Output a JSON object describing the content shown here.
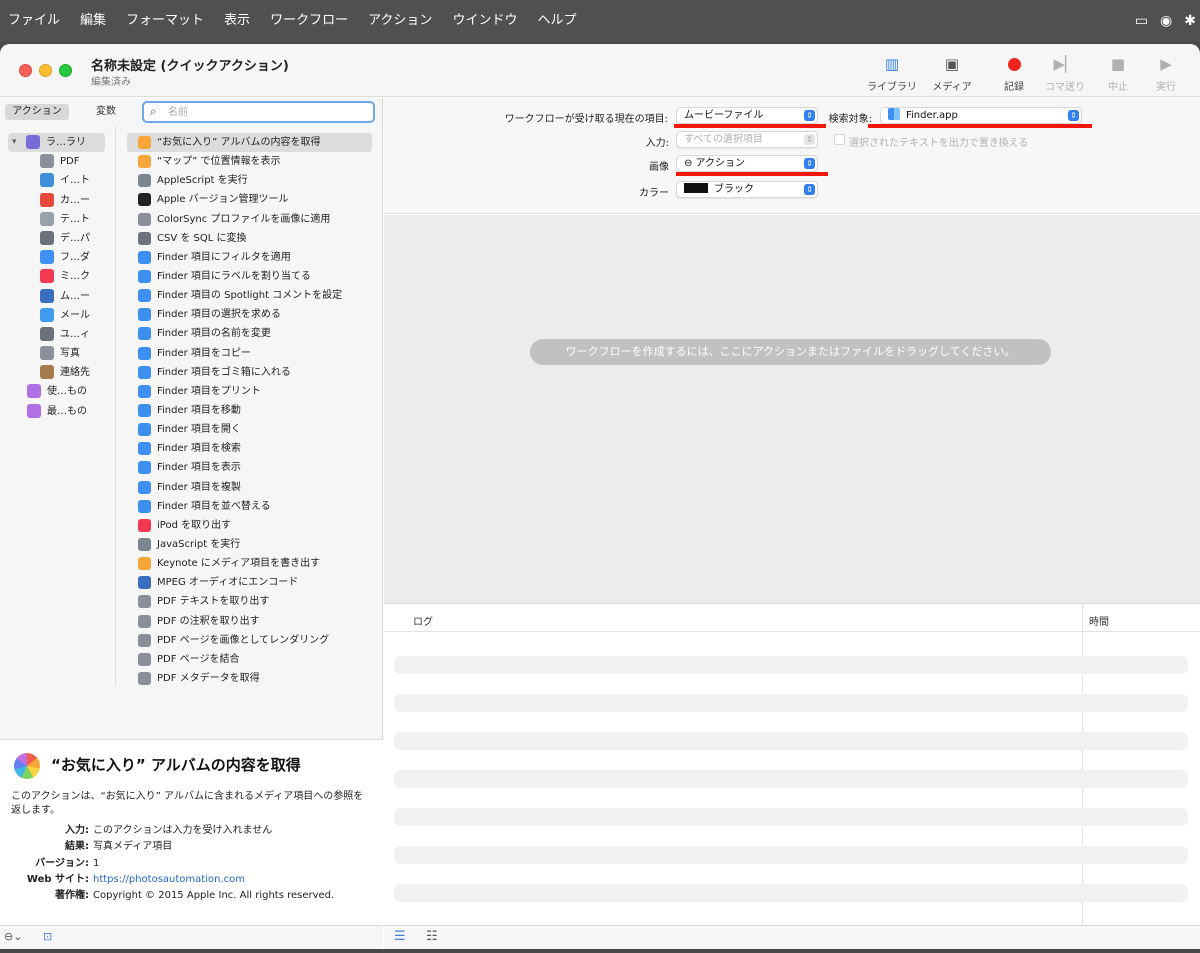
{
  "menubar": {
    "items": [
      "ファイル",
      "編集",
      "フォーマット",
      "表示",
      "ワークフロー",
      "アクション",
      "ウインドウ",
      "ヘルプ"
    ],
    "tray_icons": [
      "display-icon",
      "airplay-icon",
      "bluetooth-icon"
    ]
  },
  "window": {
    "title": "名称未設定 (クイックアクション)",
    "subtitle": "編集済み"
  },
  "toolbar": {
    "library": "ライブラリ",
    "media": "メディア",
    "record": "記録",
    "step": "コマ送り",
    "stop": "中止",
    "run": "実行"
  },
  "left_tabs": {
    "actions": "アクション",
    "variables": "変数",
    "search_placeholder": "名前"
  },
  "library": {
    "root": "ラ…ラリ",
    "items": [
      {
        "label": "PDF",
        "icon": "pdf-icon",
        "color": "#8a8f99"
      },
      {
        "label": "イ…ト",
        "icon": "globe-icon",
        "color": "#3f8fd8"
      },
      {
        "label": "カ…ー",
        "icon": "calendar-icon",
        "color": "#e8483b"
      },
      {
        "label": "テ…ト",
        "icon": "textedit-icon",
        "color": "#9aa0a8"
      },
      {
        "label": "デ…パ",
        "icon": "developer-tools-icon",
        "color": "#6d7178"
      },
      {
        "label": "フ…ダ",
        "icon": "finder-icon",
        "color": "#3d8ff2"
      },
      {
        "label": "ミ…ク",
        "icon": "music-icon",
        "color": "#f2394f"
      },
      {
        "label": "ム…ー",
        "icon": "quicktime-icon",
        "color": "#3a6fc0"
      },
      {
        "label": "メール",
        "icon": "mail-icon",
        "color": "#3f9af0"
      },
      {
        "label": "ユ…ィ",
        "icon": "utilities-icon",
        "color": "#6d7178"
      },
      {
        "label": "写真",
        "icon": "photos-icon",
        "color": "#8a8f99"
      },
      {
        "label": "連絡先",
        "icon": "contacts-icon",
        "color": "#a57a4c"
      }
    ],
    "smart": [
      {
        "label": "使…もの",
        "icon": "smart-folder-icon",
        "color": "#b06fe3"
      },
      {
        "label": "最…もの",
        "icon": "smart-folder-icon",
        "color": "#b06fe3"
      }
    ]
  },
  "actions": [
    {
      "label": "“お気に入り” アルバムの内容を取得",
      "icon": "photos-icon",
      "color": "#f7a63a",
      "selected": true
    },
    {
      "label": "“マップ” で位置情報を表示",
      "icon": "photos-icon",
      "color": "#f7a63a"
    },
    {
      "label": "AppleScript を実行",
      "icon": "script-icon",
      "color": "#7d8590"
    },
    {
      "label": "Apple バージョン管理ツール",
      "icon": "terminal-icon",
      "color": "#222222"
    },
    {
      "label": "ColorSync プロファイルを画像に適用",
      "icon": "colorsync-icon",
      "color": "#8a8f99"
    },
    {
      "label": "CSV を SQL に変換",
      "icon": "developer-tools-icon",
      "color": "#6d7178"
    },
    {
      "label": "Finder 項目にフィルタを適用",
      "icon": "finder-icon",
      "color": "#3d8ff2"
    },
    {
      "label": "Finder 項目にラベルを割り当てる",
      "icon": "finder-icon",
      "color": "#3d8ff2"
    },
    {
      "label": "Finder 項目の Spotlight コメントを設定",
      "icon": "finder-icon",
      "color": "#3d8ff2"
    },
    {
      "label": "Finder 項目の選択を求める",
      "icon": "finder-icon",
      "color": "#3d8ff2"
    },
    {
      "label": "Finder 項目の名前を変更",
      "icon": "finder-icon",
      "color": "#3d8ff2"
    },
    {
      "label": "Finder 項目をコピー",
      "icon": "finder-icon",
      "color": "#3d8ff2"
    },
    {
      "label": "Finder 項目をゴミ箱に入れる",
      "icon": "finder-icon",
      "color": "#3d8ff2"
    },
    {
      "label": "Finder 項目をプリント",
      "icon": "finder-icon",
      "color": "#3d8ff2"
    },
    {
      "label": "Finder 項目を移動",
      "icon": "finder-icon",
      "color": "#3d8ff2"
    },
    {
      "label": "Finder 項目を開く",
      "icon": "finder-icon",
      "color": "#3d8ff2"
    },
    {
      "label": "Finder 項目を検索",
      "icon": "finder-icon",
      "color": "#3d8ff2"
    },
    {
      "label": "Finder 項目を表示",
      "icon": "finder-icon",
      "color": "#3d8ff2"
    },
    {
      "label": "Finder 項目を複製",
      "icon": "finder-icon",
      "color": "#3d8ff2"
    },
    {
      "label": "Finder 項目を並べ替える",
      "icon": "finder-icon",
      "color": "#3d8ff2"
    },
    {
      "label": "iPod を取り出す",
      "icon": "music-icon",
      "color": "#f2394f"
    },
    {
      "label": "JavaScript を実行",
      "icon": "script-icon",
      "color": "#7d8590"
    },
    {
      "label": "Keynote にメディア項目を書き出す",
      "icon": "photos-icon",
      "color": "#f7a63a"
    },
    {
      "label": "MPEG オーディオにエンコード",
      "icon": "quicktime-icon",
      "color": "#3a6fc0"
    },
    {
      "label": "PDF テキストを取り出す",
      "icon": "pdf-icon",
      "color": "#8a8f99"
    },
    {
      "label": "PDF の注釈を取り出す",
      "icon": "pdf-icon",
      "color": "#8a8f99"
    },
    {
      "label": "PDF ページを画像としてレンダリング",
      "icon": "pdf-icon",
      "color": "#8a8f99"
    },
    {
      "label": "PDF ページを結合",
      "icon": "pdf-icon",
      "color": "#8a8f99"
    },
    {
      "label": "PDF メタデータを取得",
      "icon": "pdf-icon",
      "color": "#8a8f99"
    }
  ],
  "description": {
    "title": "“お気に入り” アルバムの内容を取得",
    "body": "このアクションは、“お気に入り” アルバムに含まれるメディア項目への参照を返します。",
    "input_key": "入力:",
    "input_val": "このアクションは入力を受け入れません",
    "result_key": "結果:",
    "result_val": "写真メディア項目",
    "version_key": "バージョン:",
    "version_val": "1",
    "website_key": "Web サイト:",
    "website_val": "https://photosautomation.com",
    "copyright_key": "著作権:",
    "copyright_val": "Copyright © 2015 Apple Inc. All rights reserved."
  },
  "settings": {
    "receives_label": "ワークフローが受け取る現在の項目:",
    "receives_value": "ムービーファイル",
    "search_label": "検索対象:",
    "search_value": "Finder.app",
    "input_label": "入力:",
    "input_value": "すべての選択項目",
    "replace_label": "選択されたテキストを出力で置き換える",
    "image_label": "画像",
    "image_value": "⊖ アクション",
    "color_label": "カラー",
    "color_value": "ブラック",
    "accent": "#2f7ff0",
    "annotation_color": "#f0180c"
  },
  "workflow": {
    "drop_hint": "ワークフローを作成するには、ここにアクションまたはファイルをドラッグしてください。"
  },
  "log": {
    "col_log": "ログ",
    "col_time": "時間"
  }
}
